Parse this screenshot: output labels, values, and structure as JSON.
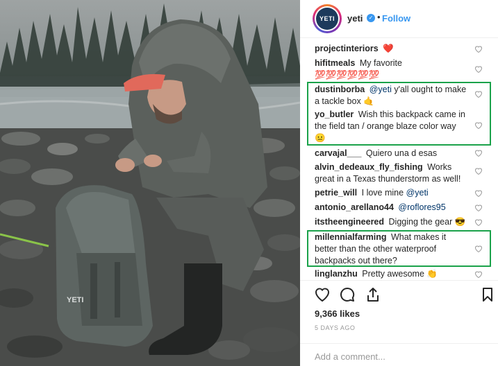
{
  "post": {
    "username": "yeti",
    "avatar_text": "YETI",
    "follow_label": "Follow",
    "separator": "•",
    "verified_icon": "verified-badge-icon",
    "likes": "9,366 likes",
    "timestamp": "5 DAYS AGO",
    "comment_placeholder": "Add a comment..."
  },
  "comments": [
    {
      "user": "projectinteriors",
      "text": "",
      "emoji": "❤️",
      "highlighted": false
    },
    {
      "user": "hifitmeals",
      "text": "My favorite",
      "emoji": "💯💯💯💯💯💯",
      "highlighted": false
    },
    {
      "user": "dustinborba",
      "mention": "@yeti",
      "text": "y'all ought to make a tackle box",
      "emoji": "🤙",
      "highlighted": true
    },
    {
      "user": "yo_butler",
      "text": "Wish this backpack came in the field tan / orange blaze color way",
      "emoji": "😐",
      "highlighted": true
    },
    {
      "user": "carvajal___",
      "text": "Quiero una d esas",
      "emoji": "",
      "highlighted": false
    },
    {
      "user": "alvin_dedeaux_fly_fishing",
      "text": "Works great in a Texas thunderstorm as well!",
      "emoji": "",
      "highlighted": false
    },
    {
      "user": "petrie_will",
      "text": "I love mine",
      "mention": "@yeti",
      "emoji": "",
      "highlighted": false
    },
    {
      "user": "antonio_arellano44",
      "mention": "@roflores95",
      "text": "",
      "emoji": "",
      "highlighted": false
    },
    {
      "user": "itstheengineered",
      "text": "Digging the gear",
      "emoji": "😎",
      "highlighted": false
    },
    {
      "user": "millennialfarming",
      "text": "What makes it better than the other waterproof backpacks out there?",
      "emoji": "",
      "highlighted": true
    },
    {
      "user": "linglanzhu",
      "text": "Pretty awesome",
      "emoji": "👏",
      "highlighted": false
    }
  ],
  "photo": {
    "backpack_logo": "YETI"
  },
  "icons": {
    "like": "heart-icon",
    "comment": "comment-icon",
    "share": "share-icon",
    "save": "bookmark-icon"
  },
  "colors": {
    "highlight_box": "#1aa24a",
    "follow_blue": "#3897f0",
    "mention_blue": "#003569"
  }
}
